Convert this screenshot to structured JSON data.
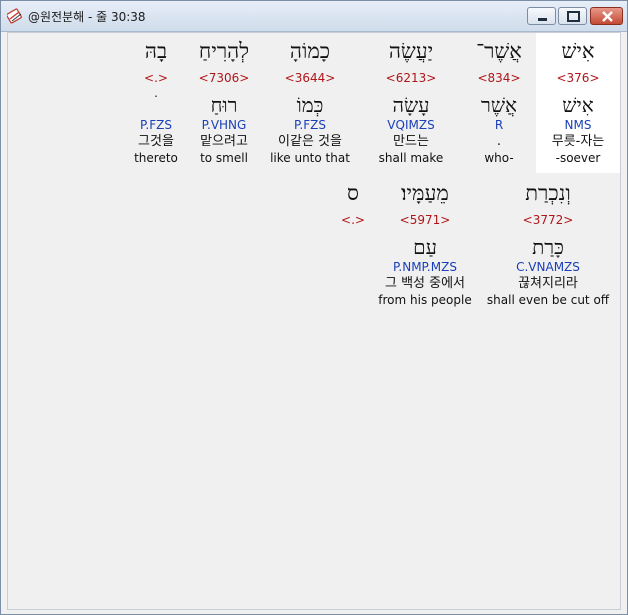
{
  "window": {
    "title": "@원전분해 - 줄 30:38"
  },
  "icons": {
    "app": "hebrew-tool-app-icon",
    "minimize": "minimize-icon",
    "maximize": "maximize-icon",
    "close": "close-icon"
  },
  "colors": {
    "strong": "#b0151a",
    "morph": "#1a3fb8",
    "selected_bg": "#ffffff"
  },
  "row1": [
    {
      "heb": "אִישׁ",
      "strong": "<376>",
      "lemma": "אִישׁ",
      "morph": "NMS",
      "kor": "무릇-자는",
      "eng": "-soever"
    },
    {
      "heb": "אֲשֶׁר־",
      "strong": "<834>",
      "lemma": "אֲשֶׁר",
      "morph": "R",
      "kor": ".",
      "eng": "who-"
    },
    {
      "heb": "יַעֲשֶׂה",
      "strong": "<6213>",
      "lemma": "עָשָׂה",
      "morph": "VQIMZS",
      "kor": "만드는",
      "eng": "shall make"
    },
    {
      "heb": "כָמוֹהָ",
      "strong": "<3644>",
      "lemma": "כְּמוֹ",
      "morph": "P.FZS",
      "kor": "이같은 것을",
      "eng": "like unto that"
    },
    {
      "heb": "לְהָרִיחַ",
      "strong": "<7306>",
      "lemma": "רוּחַ",
      "morph": "P.VHNG",
      "kor": "맡으려고",
      "eng": "to smell"
    },
    {
      "heb": "בָהּ",
      "strong": "<.>",
      "lemma": "ׄ",
      "morph": "P.FZS",
      "kor": "그것을",
      "eng": "thereto"
    }
  ],
  "row2": [
    {
      "heb": "וְנִכְרַת",
      "strong": "<3772>",
      "lemma": "כָּרַת",
      "morph": "C.VNAMZS",
      "kor": "끊쳐지리라",
      "eng": "shall even be cut off"
    },
    {
      "heb": "מֵעַמָּיו׃",
      "strong": "<5971>",
      "lemma": "עַם",
      "morph": "P.NMP.MZS",
      "kor": "그 백성 중에서",
      "eng": "from his people"
    },
    {
      "heb": "ס",
      "strong": "<.>"
    }
  ]
}
